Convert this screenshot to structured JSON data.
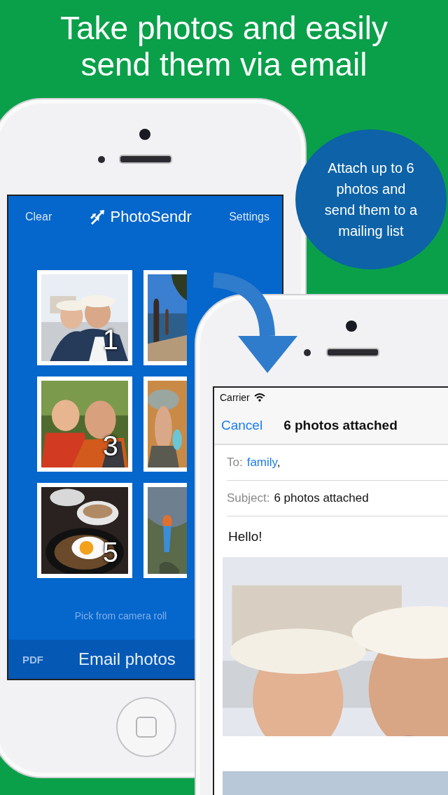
{
  "headline": "Take photos and easily send them via email",
  "callout": "Attach up to 6 photos and send them to a mailing list",
  "app": {
    "left_button": "Clear",
    "title": "PhotoSendr",
    "right_button": "Settings",
    "photo_rows": [
      {
        "number": "1"
      },
      {
        "number": "3"
      },
      {
        "number": "5"
      }
    ],
    "pick_link": "Pick from camera roll",
    "pdf_button": "PDF",
    "email_button": "Email photos"
  },
  "mail": {
    "carrier": "Carrier",
    "cancel": "Cancel",
    "title": "6 photos attached",
    "to_label": "To:",
    "to_value": "family",
    "to_separator": ",",
    "subject_label": "Subject:",
    "subject": "6 photos attached",
    "body": "Hello!"
  }
}
